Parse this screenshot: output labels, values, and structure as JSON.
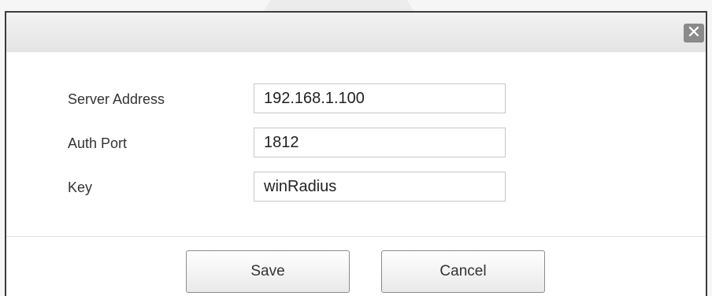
{
  "dialog": {
    "close_glyph": "✕",
    "close_icon": "close-icon"
  },
  "form": {
    "fields": [
      {
        "label": "Server Address",
        "value": "192.168.1.100"
      },
      {
        "label": "Auth Port",
        "value": "1812"
      },
      {
        "label": "Key",
        "value": "winRadius"
      }
    ]
  },
  "buttons": {
    "save_label": "Save",
    "cancel_label": "Cancel"
  }
}
